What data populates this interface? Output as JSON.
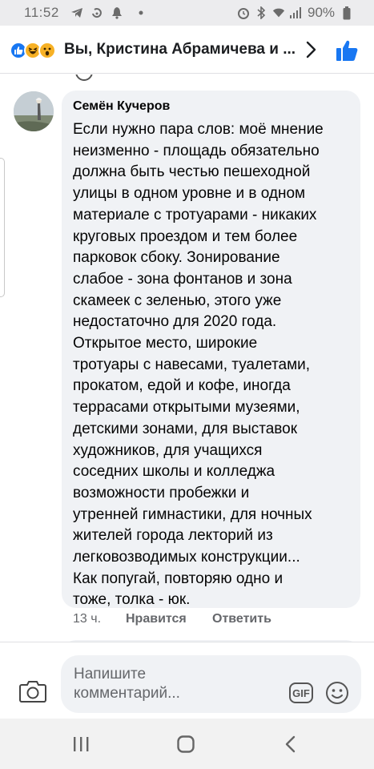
{
  "status_bar": {
    "time": "11:52",
    "battery": "90%",
    "icons_left": [
      "telegram-icon",
      "sync-icon",
      "notification-bell-icon",
      "dot-icon"
    ],
    "icons_right": [
      "alarm-icon",
      "bluetooth-icon",
      "wifi-icon",
      "signal-icon",
      "battery-icon"
    ]
  },
  "header": {
    "reactions": [
      "like",
      "haha",
      "wow"
    ],
    "title": "Вы, Кристина Абрамичева и ...",
    "accent_color": "#1877f2"
  },
  "comment": {
    "author": "Семён Кучеров",
    "text": "Если нужно пара слов: моё мнение\nнеизменно - площадь обязательно\nдолжна быть честью пешеходной\nулицы в одном уровне  и в одном\nматериале с тротуарами - никаких\nкруговых проездом и тем более\nпарковок сбоку. Зонирование\nслабое - зона фонтанов и зона\nскамеек с зеленью, этого уже\nнедостаточно для 2020 года.\nОткрытое место, широкие\nтротуары с навесами, туалетами,\nпрокатом, едой и кофе, иногда\nтеррасами открытыми музеями,\nдетскими зонами, для выставок\nхудожников, для учащихся\nсоседних школы и колледжа\nвозможности пробежки и\nутренней гимнастики, для ночных\nжителей города лекторий из\nлегковозводимых конструкции...\nКак попугай, повторяю одно и\nтоже, толка - юк.",
    "time_ago": "13 ч.",
    "like_label": "Нравится",
    "reply_label": "Ответить"
  },
  "composer": {
    "placeholder": "Напишите комментарий...",
    "gif_label": "GIF"
  },
  "navbar": {
    "buttons": [
      "recent-apps",
      "home",
      "back"
    ]
  }
}
